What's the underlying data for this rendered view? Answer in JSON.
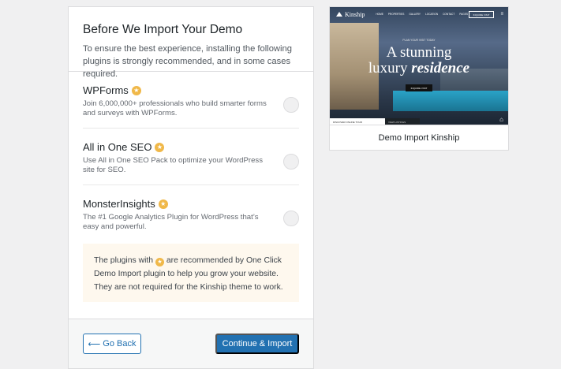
{
  "modal": {
    "title": "Before We Import Your Demo",
    "description": "To ensure the best experience, installing the following plugins is strongly recommended, and in some cases required."
  },
  "plugins": [
    {
      "name": "WPForms",
      "description": "Join 6,000,000+ professionals who build smarter forms and surveys with WPForms.",
      "recommended": true
    },
    {
      "name": "All in One SEO",
      "description": "Use All in One SEO Pack to optimize your WordPress site for SEO.",
      "recommended": true
    },
    {
      "name": "MonsterInsights",
      "description": "The #1 Google Analytics Plugin for WordPress that’s easy and powerful.",
      "recommended": true
    }
  ],
  "notice": {
    "before": "The plugins with",
    "after": "are recommended by One Click Demo Import plugin to help you grow your website. They are not required for the Kinship theme to work."
  },
  "footer": {
    "back_icon": "arrow-left-icon",
    "back_label": "Go Back",
    "continue_label": "Continue & Import"
  },
  "preview": {
    "logo": "Kinship",
    "nav_items": [
      "HOME",
      "PROPERTIES",
      "GALLERY",
      "LOCATION",
      "CONTACT",
      "PAGES"
    ],
    "nav_button": "INQUIRE VISIT",
    "hero_subtitle": "PLAN YOUR VISIT TODAY",
    "hero_line1": "A stunning",
    "hero_line2_plain": "luxury",
    "hero_line2_em": "residence",
    "hero_button": "INQUIRE VISIT",
    "bottom_left": "DISCOVER ONLINE TOUR",
    "bottom_right": "VIEW LISTINGS",
    "caption": "Demo Import Kinship"
  },
  "colors": {
    "accent": "#2271b1",
    "star": "#f0b849",
    "notice_bg": "#fef8ee"
  }
}
